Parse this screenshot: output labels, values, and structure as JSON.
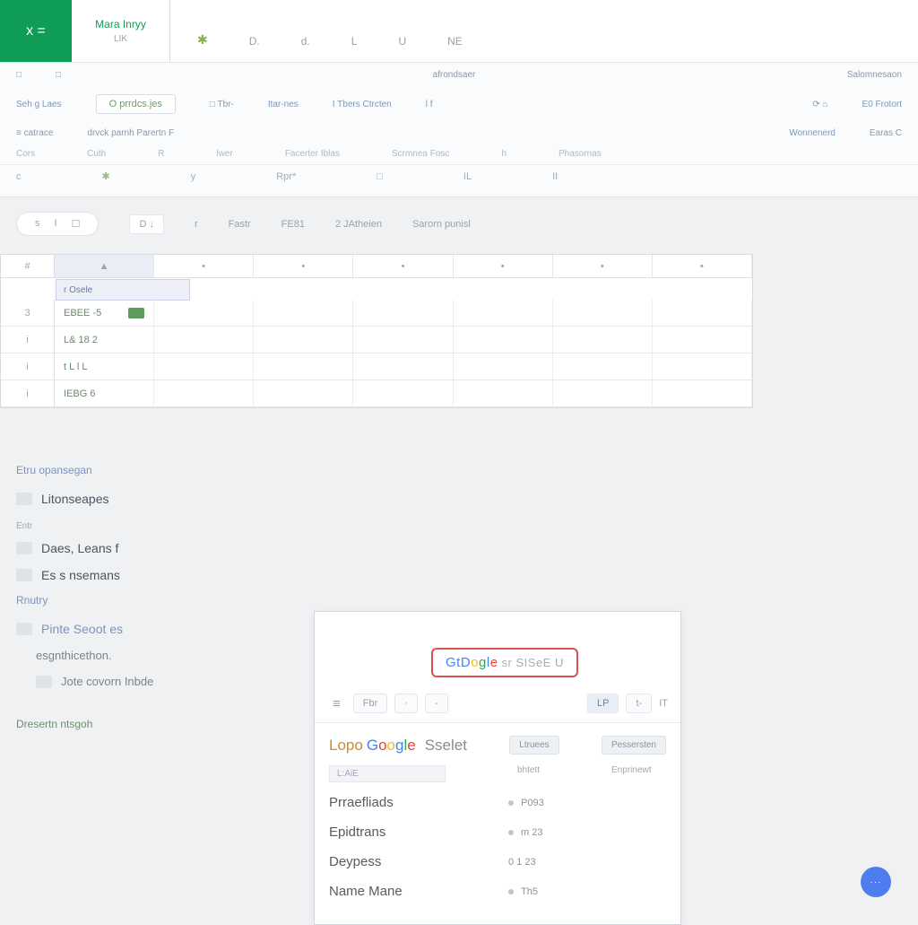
{
  "appbar": {
    "logo_sym": "x  =",
    "logo_sub": "··",
    "title1": "Mara  Inryy",
    "title2": "LIK",
    "tabs": [
      "D.",
      "d.",
      "L",
      "U",
      "NE"
    ]
  },
  "ribbon": {
    "r1_left": [
      "□",
      "□"
    ],
    "r1_center": "afrondsaer",
    "r1_right": "Salomnesaon",
    "r2_left_label": "Seh g  Laes",
    "r2_chip": "O  prrdcs.jes",
    "r2_items": [
      "□ Tbr-",
      "Itar-nes",
      "I Tbers Ctrcten",
      "l f",
      "⟳  ⌂",
      "E0 Frotort"
    ],
    "r3_left": "≡ catrace",
    "r3_mid": "drvck parnh Parertn F",
    "r3_right": [
      "Wonnenerd",
      "Earas  C"
    ],
    "r4": [
      "Cors",
      "Cuth",
      "R",
      "lwer",
      "Facerter  Iblas",
      "Scrmnea Fosc",
      "h",
      "Phasornas"
    ],
    "r5": [
      "c",
      "✱",
      "y",
      "Rpr*",
      "□",
      "IL",
      "II"
    ]
  },
  "formula": {
    "pill": [
      "s",
      "I",
      "☐"
    ],
    "mini": "D ↓",
    "labels": [
      "r",
      "Fastr",
      "FE81",
      "2 JAtheien",
      "Sarorn punisl"
    ]
  },
  "grid": {
    "cols": [
      "#",
      "▲",
      "•",
      "•",
      "•",
      "•",
      "•",
      "•"
    ],
    "namecell": "r Osele",
    "rows": [
      {
        "n": "3",
        "a": "EBEE -5",
        "sel": true
      },
      {
        "n": "i",
        "a": "L&  18  2"
      },
      {
        "n": "i",
        "a": "t L  l L"
      },
      {
        "n": "i",
        "a": "IEBG 6"
      }
    ]
  },
  "side": {
    "sec1": "Etru opansegan",
    "items1": [
      {
        "label": "Litonseapes",
        "sub": false
      },
      {
        "label": "Daes, Leans  f",
        "sub": false,
        "cat": "Entr"
      },
      {
        "label": "Es s  nsemans",
        "sub": false
      }
    ],
    "sec2": "Rnutry",
    "items2": [
      {
        "label": "Pinte  Seoot  es",
        "sub": false,
        "link": true
      },
      {
        "label": "esgnthicethon.",
        "sub": true
      },
      {
        "label": "Jote  covorn  Inbde",
        "sub": true
      }
    ],
    "footer": "Dresertn   ntsgoh"
  },
  "popup": {
    "badge_pre": "GtD",
    "badge_mid": "ogle",
    "badge_tail": "sr SISeE U",
    "toolbar": [
      "Fbr",
      "·",
      "-",
      "LP",
      "t-",
      "IT"
    ],
    "brand_pre": "Lopo",
    "brand_google": "Google",
    "brand_tail": "Sselet",
    "brand_btn1": "Ltruees",
    "brand_btn2": "Pessersten",
    "col_hdr1": "L:AiE",
    "col_hdr2": "bhtett",
    "col_hdr3": "Enprinewt",
    "rows": [
      {
        "k": "Prraefliads",
        "v": "P093"
      },
      {
        "k": "Epidtrans",
        "v": "m 23"
      },
      {
        "k": "Deypess",
        "v": "0 1 23"
      },
      {
        "k": "Name Mane",
        "v": "Th5"
      }
    ]
  },
  "fab": "···"
}
